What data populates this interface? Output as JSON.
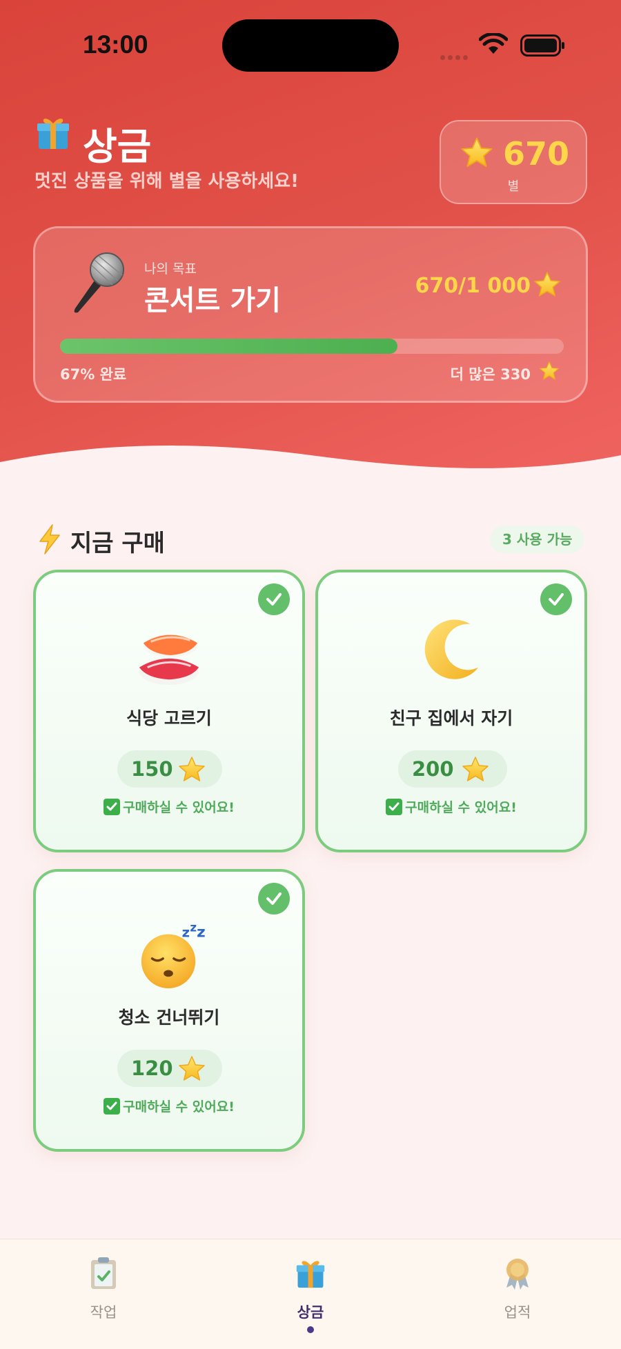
{
  "status_bar": {
    "time": "13:00"
  },
  "header": {
    "title": "상금",
    "subtitle": "멋진 상품을 위해 별을 사용하세요!",
    "stars": {
      "value": "670",
      "label": "별"
    }
  },
  "goal": {
    "kicker": "나의 목표",
    "name": "콘서트 가기",
    "progress_text": "670/1 000",
    "progress_fraction": 0.67,
    "progress_label": "67% 완료",
    "remaining_label": "더 많은 330"
  },
  "section": {
    "title": "지금 구매",
    "available_badge": "3 사용 가능"
  },
  "rewards": [
    {
      "name": "식당 고르기",
      "price": "150",
      "status": "구매하실 수 있어요!",
      "icon": "sushi-icon"
    },
    {
      "name": "친구 집에서 자기",
      "price": "200",
      "status": "구매하실 수 있어요!",
      "icon": "moon-icon"
    },
    {
      "name": "청소 건너뛰기",
      "price": "120",
      "status": "구매하실 수 있어요!",
      "icon": "sleeping-face-icon"
    }
  ],
  "tabs": [
    {
      "label": "작업",
      "icon": "clipboard-icon",
      "active": false
    },
    {
      "label": "상금",
      "icon": "gift-icon",
      "active": true
    },
    {
      "label": "업적",
      "icon": "medal-icon",
      "active": false
    }
  ],
  "colors": {
    "hero_red": "#d9433a",
    "accent_green": "#63bf6a",
    "star_yellow": "#ffd54a",
    "active_tab": "#3f2f6e"
  }
}
